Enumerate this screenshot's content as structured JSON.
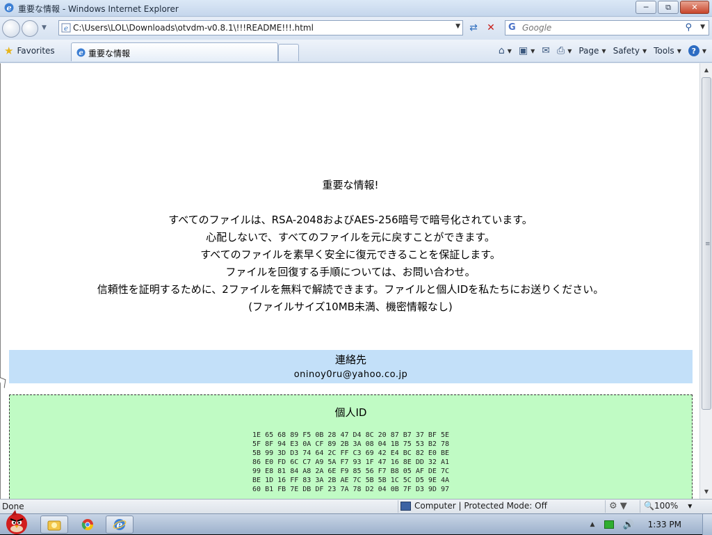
{
  "window": {
    "title": "重要な情報 - Windows Internet Explorer"
  },
  "addressbar": {
    "url": "C:\\Users\\LOL\\Downloads\\otvdm-v0.8.1\\!!!README!!!.html",
    "search_placeholder": "Google"
  },
  "commandbar": {
    "favorites_label": "Favorites",
    "tab_title": "重要な情報",
    "page_label": "Page",
    "safety_label": "Safety",
    "tools_label": "Tools"
  },
  "content": {
    "heading": "重要な情報!",
    "lines": [
      "すべてのファイルは、RSA-2048およびAES-256暗号で暗号化されています。",
      "心配しないで、すべてのファイルを元に戻すことができます。",
      "すべてのファイルを素早く安全に復元できることを保証します。",
      "ファイルを回復する手順については、お問い合わせ。",
      "信頼性を証明するために、2ファイルを無料で解読できます。ファイルと個人IDを私たちにお送りください。",
      "(ファイルサイズ10MB未満、機密情報なし)"
    ],
    "contact_title": "連絡先",
    "contact_email": "oninoy0ru@yahoo.co.jp",
    "id_title": "個人ID",
    "id_hex": [
      "1E 65 68 89 F5 0B 28 47 D4 8C 20 87 B7 37 BF 5E",
      "5F 8F 94 E3 0A CF 89 2B 3A 08 04 1B 75 53 B2 78",
      "5B 99 3D D3 74 64 2C FF C3 69 42 E4 BC 82 E0 BE",
      "86 E0 FD 6C C7 A9 5A F7 93 1F 47 16 8E DD 32 A1",
      "99 E8 81 84 A8 2A 6E F9 85 56 F7 B8 05 AF DE 7C",
      "BE 1D 16 FF 83 3A 2B AE 7C 5B 5B 1C 5C D5 9E 4A",
      "60 B1 FB 7E DB DF 23 7A 78 D2 04 0B 7F D3 9D 97"
    ]
  },
  "statusbar": {
    "status_text": "Done",
    "zone_text": "Computer | Protected Mode: Off",
    "zoom_text": "100%"
  },
  "taskbar": {
    "clock": "1:33 PM"
  },
  "colors": {
    "contact_bg": "#c3e0f9",
    "id_bg": "#c0fbc4"
  }
}
